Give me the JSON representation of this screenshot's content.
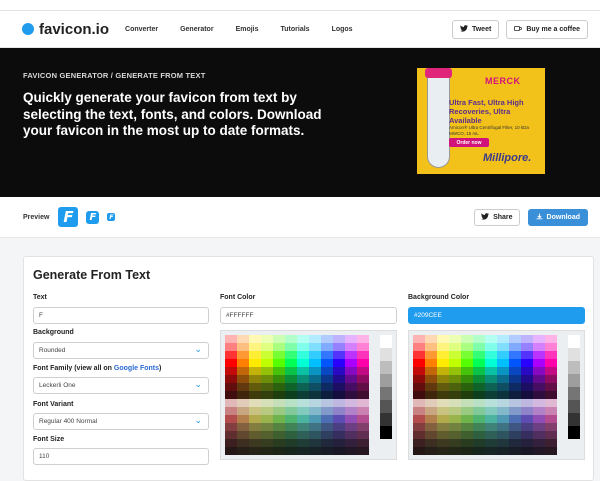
{
  "nav": {
    "logo": "favicon.io",
    "links": [
      "Converter",
      "Generator",
      "Emojis",
      "Tutorials",
      "Logos"
    ],
    "tweet": "Tweet",
    "coffee": "Buy me a coffee"
  },
  "hero": {
    "breadcrumb": "FAVICON GENERATOR / GENERATE FROM TEXT",
    "text": "Quickly generate your favicon from text by selecting the text, fonts, and colors. Download your favicon in the most up to date formats."
  },
  "ad": {
    "brand": "MERCK",
    "headline": "Ultra Fast, Ultra High Recoveries, Ultra Available",
    "sub": "Amicon® Ultra Centrifugal Filter, 10 kDa MWCO, 15 mL",
    "cta": "Order now",
    "footer": "Millipore."
  },
  "preview": {
    "label": "Preview",
    "letter": "F",
    "share": "Share",
    "download": "Download"
  },
  "form": {
    "title": "Generate From Text",
    "text_label": "Text",
    "text_value": "F",
    "background_label": "Background",
    "background_value": "Rounded",
    "font_family_label": "Font Family (view all on",
    "font_family_link": "Google Fonts",
    "font_family_close": ")",
    "font_family_value": "Leckerli One",
    "font_variant_label": "Font Variant",
    "font_variant_value": "Regular 400 Normal",
    "font_size_label": "Font Size",
    "font_size_value": "110",
    "font_color_label": "Font Color",
    "font_color_value": "#FFFFFF",
    "bg_color_label": "Background Color",
    "bg_color_value": "#209CEE"
  },
  "colors": {
    "accent": "#209cee",
    "download": "#3a8fd9",
    "hero_bg": "#0c0c0c"
  },
  "icons": [
    "twitter-icon",
    "coffee-icon",
    "share-icon",
    "download-icon"
  ]
}
